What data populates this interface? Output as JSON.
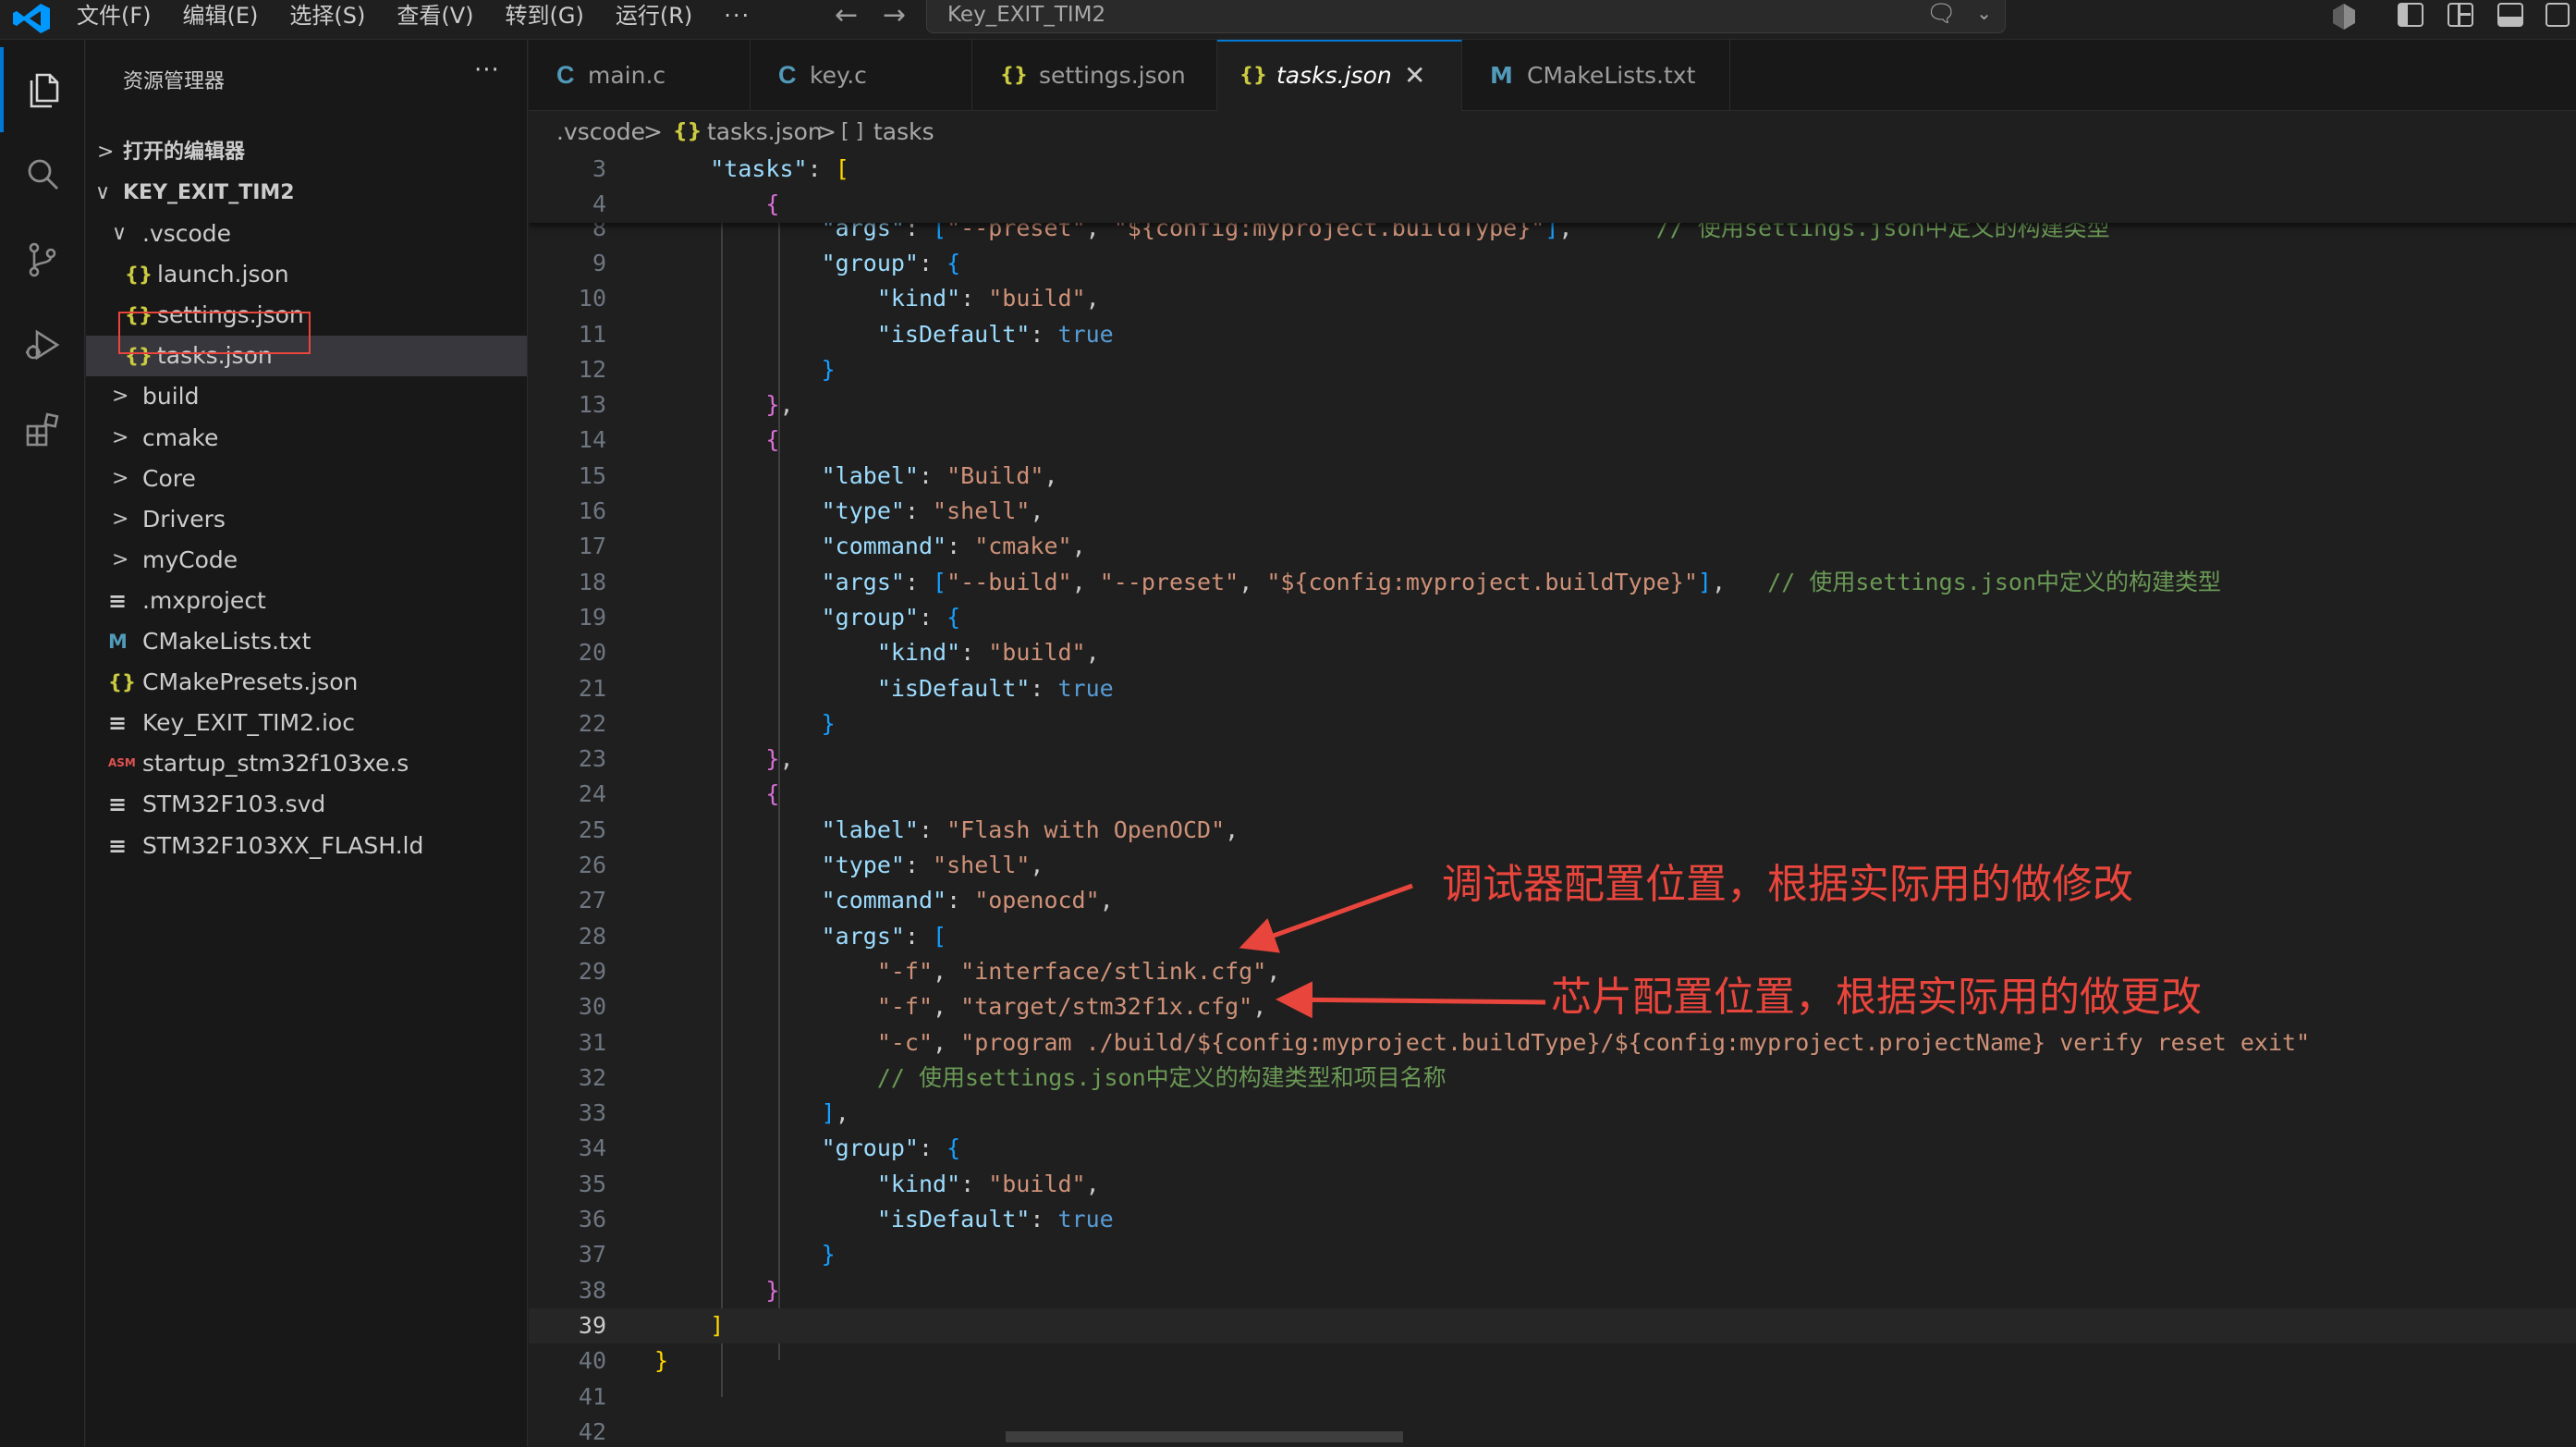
{
  "titlebar": {
    "menus": [
      {
        "label": "文件(F)"
      },
      {
        "label": "编辑(E)"
      },
      {
        "label": "选择(S)"
      },
      {
        "label": "查看(V)"
      },
      {
        "label": "转到(G)"
      },
      {
        "label": "运行(R)"
      },
      {
        "label": "···"
      }
    ],
    "search_text": "Key_EXIT_TIM2"
  },
  "activity_bar": [
    "files-icon",
    "search-icon",
    "source-control-icon",
    "run-debug-icon",
    "extensions-icon"
  ],
  "sidebar": {
    "title": "资源管理器",
    "more": "···",
    "open_editors": "打开的编辑器",
    "project": "KEY_EXIT_TIM2",
    "items": [
      {
        "label": ".vscode",
        "chev": "∨",
        "icon": ""
      },
      {
        "label": "launch.json",
        "icon": "{}"
      },
      {
        "label": "settings.json",
        "icon": "{}"
      },
      {
        "label": "tasks.json",
        "icon": "{}"
      },
      {
        "label": "build",
        "chev": ">",
        "icon": ""
      },
      {
        "label": "cmake",
        "chev": ">",
        "icon": ""
      },
      {
        "label": "Core",
        "chev": ">",
        "icon": ""
      },
      {
        "label": "Drivers",
        "chev": ">",
        "icon": ""
      },
      {
        "label": "myCode",
        "chev": ">",
        "icon": ""
      },
      {
        "label": ".mxproject",
        "icon": "≡"
      },
      {
        "label": "CMakeLists.txt",
        "icon": "M"
      },
      {
        "label": "CMakePresets.json",
        "icon": "{}"
      },
      {
        "label": "Key_EXIT_TIM2.ioc",
        "icon": "≡"
      },
      {
        "label": "startup_stm32f103xe.s",
        "icon": "ASM"
      },
      {
        "label": "STM32F103.svd",
        "icon": "≡"
      },
      {
        "label": "STM32F103XX_FLASH.ld",
        "icon": "≡"
      }
    ]
  },
  "tabs": [
    {
      "label": "main.c",
      "icon": "C"
    },
    {
      "label": "key.c",
      "icon": "C"
    },
    {
      "label": "settings.json",
      "icon": "{}"
    },
    {
      "label": "tasks.json",
      "icon": "{}",
      "close": "✕"
    },
    {
      "label": "CMakeLists.txt",
      "icon": "M"
    }
  ],
  "breadcrumb": [
    ".vscode",
    ">",
    "{}",
    "tasks.json",
    ">",
    "[ ]",
    "tasks"
  ],
  "editor": {
    "current_line": 39,
    "sticky_lines": [
      {
        "n": "3",
        "tokens": [
          [
            "punc",
            "    "
          ],
          [
            "key",
            "\"tasks\""
          ],
          [
            "punc",
            ": "
          ],
          [
            "b1",
            "["
          ]
        ]
      },
      {
        "n": "4",
        "tokens": [
          [
            "punc",
            "        "
          ],
          [
            "b2",
            "{"
          ]
        ]
      }
    ],
    "lines": [
      {
        "n": "8",
        "tokens": [
          [
            "punc",
            "            "
          ],
          [
            "key",
            "\"args\""
          ],
          [
            "punc",
            ": "
          ],
          [
            "b3",
            "["
          ],
          [
            "str",
            "\"--preset\""
          ],
          [
            "punc",
            ", "
          ],
          [
            "str",
            "\"${config:myproject.buildType}\""
          ],
          [
            "b3",
            "]"
          ],
          [
            "punc",
            ",      "
          ],
          [
            "cmt",
            "// 使用settings.json中定义的构建类型"
          ]
        ]
      },
      {
        "n": "9",
        "tokens": [
          [
            "punc",
            "            "
          ],
          [
            "key",
            "\"group\""
          ],
          [
            "punc",
            ": "
          ],
          [
            "b3",
            "{"
          ]
        ]
      },
      {
        "n": "10",
        "tokens": [
          [
            "punc",
            "                "
          ],
          [
            "key",
            "\"kind\""
          ],
          [
            "punc",
            ": "
          ],
          [
            "str",
            "\"build\""
          ],
          [
            "punc",
            ","
          ]
        ]
      },
      {
        "n": "11",
        "tokens": [
          [
            "punc",
            "                "
          ],
          [
            "key",
            "\"isDefault\""
          ],
          [
            "punc",
            ": "
          ],
          [
            "kw",
            "true"
          ]
        ]
      },
      {
        "n": "12",
        "tokens": [
          [
            "punc",
            "            "
          ],
          [
            "b3",
            "}"
          ]
        ]
      },
      {
        "n": "13",
        "tokens": [
          [
            "punc",
            "        "
          ],
          [
            "b2",
            "}"
          ],
          [
            "punc",
            ","
          ]
        ]
      },
      {
        "n": "14",
        "tokens": [
          [
            "punc",
            "        "
          ],
          [
            "b2",
            "{"
          ]
        ]
      },
      {
        "n": "15",
        "tokens": [
          [
            "punc",
            "            "
          ],
          [
            "key",
            "\"label\""
          ],
          [
            "punc",
            ": "
          ],
          [
            "str",
            "\"Build\""
          ],
          [
            "punc",
            ","
          ]
        ]
      },
      {
        "n": "16",
        "tokens": [
          [
            "punc",
            "            "
          ],
          [
            "key",
            "\"type\""
          ],
          [
            "punc",
            ": "
          ],
          [
            "str",
            "\"shell\""
          ],
          [
            "punc",
            ","
          ]
        ]
      },
      {
        "n": "17",
        "tokens": [
          [
            "punc",
            "            "
          ],
          [
            "key",
            "\"command\""
          ],
          [
            "punc",
            ": "
          ],
          [
            "str",
            "\"cmake\""
          ],
          [
            "punc",
            ","
          ]
        ]
      },
      {
        "n": "18",
        "tokens": [
          [
            "punc",
            "            "
          ],
          [
            "key",
            "\"args\""
          ],
          [
            "punc",
            ": "
          ],
          [
            "b3",
            "["
          ],
          [
            "str",
            "\"--build\""
          ],
          [
            "punc",
            ", "
          ],
          [
            "str",
            "\"--preset\""
          ],
          [
            "punc",
            ", "
          ],
          [
            "str",
            "\"${config:myproject.buildType}\""
          ],
          [
            "b3",
            "]"
          ],
          [
            "punc",
            ",   "
          ],
          [
            "cmt",
            "// 使用settings.json中定义的构建类型"
          ]
        ]
      },
      {
        "n": "19",
        "tokens": [
          [
            "punc",
            "            "
          ],
          [
            "key",
            "\"group\""
          ],
          [
            "punc",
            ": "
          ],
          [
            "b3",
            "{"
          ]
        ]
      },
      {
        "n": "20",
        "tokens": [
          [
            "punc",
            "                "
          ],
          [
            "key",
            "\"kind\""
          ],
          [
            "punc",
            ": "
          ],
          [
            "str",
            "\"build\""
          ],
          [
            "punc",
            ","
          ]
        ]
      },
      {
        "n": "21",
        "tokens": [
          [
            "punc",
            "                "
          ],
          [
            "key",
            "\"isDefault\""
          ],
          [
            "punc",
            ": "
          ],
          [
            "kw",
            "true"
          ]
        ]
      },
      {
        "n": "22",
        "tokens": [
          [
            "punc",
            "            "
          ],
          [
            "b3",
            "}"
          ]
        ]
      },
      {
        "n": "23",
        "tokens": [
          [
            "punc",
            "        "
          ],
          [
            "b2",
            "}"
          ],
          [
            "punc",
            ","
          ]
        ]
      },
      {
        "n": "24",
        "tokens": [
          [
            "punc",
            "        "
          ],
          [
            "b2",
            "{"
          ]
        ]
      },
      {
        "n": "25",
        "tokens": [
          [
            "punc",
            "            "
          ],
          [
            "key",
            "\"label\""
          ],
          [
            "punc",
            ": "
          ],
          [
            "str",
            "\"Flash with OpenOCD\""
          ],
          [
            "punc",
            ","
          ]
        ]
      },
      {
        "n": "26",
        "tokens": [
          [
            "punc",
            "            "
          ],
          [
            "key",
            "\"type\""
          ],
          [
            "punc",
            ": "
          ],
          [
            "str",
            "\"shell\""
          ],
          [
            "punc",
            ","
          ]
        ]
      },
      {
        "n": "27",
        "tokens": [
          [
            "punc",
            "            "
          ],
          [
            "key",
            "\"command\""
          ],
          [
            "punc",
            ": "
          ],
          [
            "str",
            "\"openocd\""
          ],
          [
            "punc",
            ","
          ]
        ]
      },
      {
        "n": "28",
        "tokens": [
          [
            "punc",
            "            "
          ],
          [
            "key",
            "\"args\""
          ],
          [
            "punc",
            ": "
          ],
          [
            "b3",
            "["
          ]
        ]
      },
      {
        "n": "29",
        "tokens": [
          [
            "punc",
            "                "
          ],
          [
            "str",
            "\"-f\""
          ],
          [
            "punc",
            ", "
          ],
          [
            "str",
            "\"interface/stlink.cfg\""
          ],
          [
            "punc",
            ","
          ]
        ]
      },
      {
        "n": "30",
        "tokens": [
          [
            "punc",
            "                "
          ],
          [
            "str",
            "\"-f\""
          ],
          [
            "punc",
            ", "
          ],
          [
            "str",
            "\"target/stm32f1x.cfg\""
          ],
          [
            "punc",
            ","
          ]
        ]
      },
      {
        "n": "31",
        "tokens": [
          [
            "punc",
            "                "
          ],
          [
            "str",
            "\"-c\""
          ],
          [
            "punc",
            ", "
          ],
          [
            "str",
            "\"program ./build/${config:myproject.buildType}/${config:myproject.projectName} verify reset exit\""
          ]
        ]
      },
      {
        "n": "32",
        "tokens": [
          [
            "punc",
            "                "
          ],
          [
            "cmt",
            "// 使用settings.json中定义的构建类型和项目名称"
          ]
        ]
      },
      {
        "n": "33",
        "tokens": [
          [
            "punc",
            "            "
          ],
          [
            "b3",
            "]"
          ],
          [
            "punc",
            ","
          ]
        ]
      },
      {
        "n": "34",
        "tokens": [
          [
            "punc",
            "            "
          ],
          [
            "key",
            "\"group\""
          ],
          [
            "punc",
            ": "
          ],
          [
            "b3",
            "{"
          ]
        ]
      },
      {
        "n": "35",
        "tokens": [
          [
            "punc",
            "                "
          ],
          [
            "key",
            "\"kind\""
          ],
          [
            "punc",
            ": "
          ],
          [
            "str",
            "\"build\""
          ],
          [
            "punc",
            ","
          ]
        ]
      },
      {
        "n": "36",
        "tokens": [
          [
            "punc",
            "                "
          ],
          [
            "key",
            "\"isDefault\""
          ],
          [
            "punc",
            ": "
          ],
          [
            "kw",
            "true"
          ]
        ]
      },
      {
        "n": "37",
        "tokens": [
          [
            "punc",
            "            "
          ],
          [
            "b3",
            "}"
          ]
        ]
      },
      {
        "n": "38",
        "tokens": [
          [
            "punc",
            "        "
          ],
          [
            "b2",
            "}"
          ]
        ]
      },
      {
        "n": "39",
        "tokens": [
          [
            "punc",
            "    "
          ],
          [
            "b1",
            "]"
          ]
        ]
      },
      {
        "n": "40",
        "tokens": [
          [
            "b1",
            "}"
          ]
        ]
      },
      {
        "n": "41",
        "tokens": []
      },
      {
        "n": "42",
        "tokens": []
      }
    ]
  },
  "annotations": {
    "debugger": "调试器配置位置，根据实际用的做修改",
    "chip": "芯片配置位置，根据实际用的做更改"
  },
  "colors": {
    "accent": "#0078d4",
    "annotation_red": "#e8453c",
    "json_icon": "#cbcb41",
    "c_icon": "#519aba"
  }
}
